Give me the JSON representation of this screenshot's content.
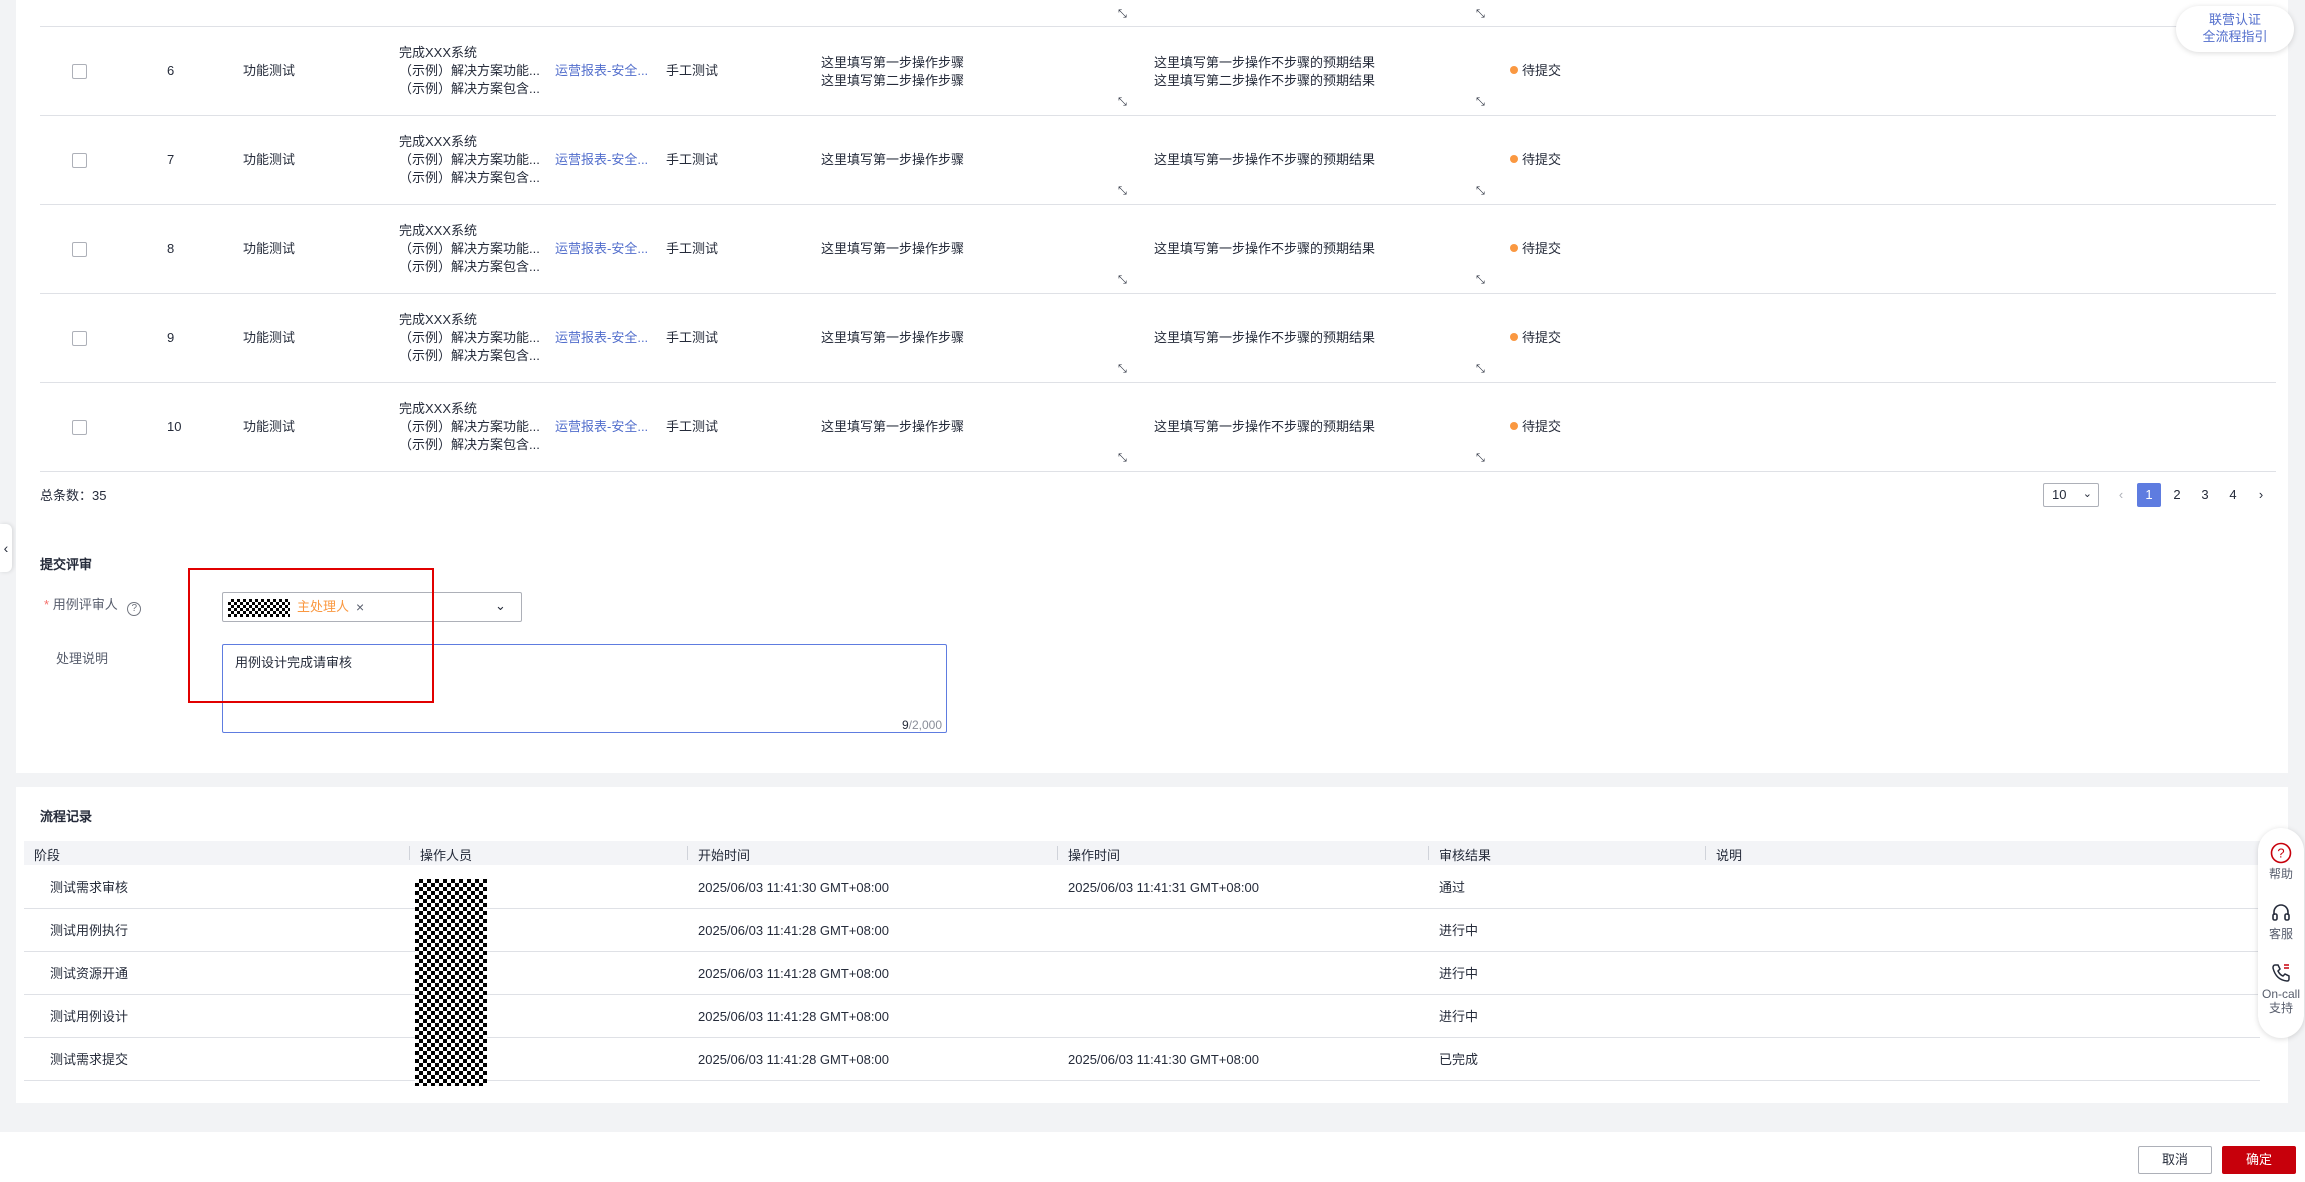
{
  "cases": {
    "rows": [
      {
        "no": "6",
        "type": "功能测试",
        "title": "完成XXX系统",
        "line1": "（示例）解决方案功能...",
        "line2": "（示例）解决方案包含...",
        "link": "运营报表-安全...",
        "method": "手工测试",
        "steps": [
          "这里填写第一步操作步骤",
          "这里填写第二步操作步骤"
        ],
        "expected": [
          "这里填写第一步操作不步骤的预期结果",
          "这里填写第二步操作不步骤的预期结果"
        ],
        "status": "待提交"
      },
      {
        "no": "7",
        "type": "功能测试",
        "title": "完成XXX系统",
        "line1": "（示例）解决方案功能...",
        "line2": "（示例）解决方案包含...",
        "link": "运营报表-安全...",
        "method": "手工测试",
        "steps": [
          "这里填写第一步操作步骤"
        ],
        "expected": [
          "这里填写第一步操作不步骤的预期结果"
        ],
        "status": "待提交"
      },
      {
        "no": "8",
        "type": "功能测试",
        "title": "完成XXX系统",
        "line1": "（示例）解决方案功能...",
        "line2": "（示例）解决方案包含...",
        "link": "运营报表-安全...",
        "method": "手工测试",
        "steps": [
          "这里填写第一步操作步骤"
        ],
        "expected": [
          "这里填写第一步操作不步骤的预期结果"
        ],
        "status": "待提交"
      },
      {
        "no": "9",
        "type": "功能测试",
        "title": "完成XXX系统",
        "line1": "（示例）解决方案功能...",
        "line2": "（示例）解决方案包含...",
        "link": "运营报表-安全...",
        "method": "手工测试",
        "steps": [
          "这里填写第一步操作步骤"
        ],
        "expected": [
          "这里填写第一步操作不步骤的预期结果"
        ],
        "status": "待提交"
      },
      {
        "no": "10",
        "type": "功能测试",
        "title": "完成XXX系统",
        "line1": "（示例）解决方案功能...",
        "line2": "（示例）解决方案包含...",
        "link": "运营报表-安全...",
        "method": "手工测试",
        "steps": [
          "这里填写第一步操作步骤"
        ],
        "expected": [
          "这里填写第一步操作不步骤的预期结果"
        ],
        "status": "待提交"
      }
    ],
    "total_label": "总条数：35",
    "page_size": "10",
    "pages": [
      "1",
      "2",
      "3",
      "4"
    ],
    "active_page": "1",
    "resize_icon": "resize-handle-icon"
  },
  "review": {
    "section_title": "提交评审",
    "reviewer_label": "用例评审人",
    "reviewer_tag": "主处理人",
    "remark_label": "处理说明",
    "remark_value": "用例设计完成请审核",
    "char_count": "9",
    "char_max": "/2,000"
  },
  "flow": {
    "title": "流程记录",
    "headers": [
      "阶段",
      "操作人员",
      "开始时间",
      "操作时间",
      "审核结果",
      "说明"
    ],
    "rows": [
      {
        "stage": "测试需求审核",
        "start": "2025/06/03 11:41:30 GMT+08:00",
        "op_time": "2025/06/03 11:41:31 GMT+08:00",
        "result": "通过"
      },
      {
        "stage": "测试用例执行",
        "start": "2025/06/03 11:41:28 GMT+08:00",
        "op_time": "",
        "result": "进行中"
      },
      {
        "stage": "测试资源开通",
        "start": "2025/06/03 11:41:28 GMT+08:00",
        "op_time": "",
        "result": "进行中"
      },
      {
        "stage": "测试用例设计",
        "start": "2025/06/03 11:41:28 GMT+08:00",
        "op_time": "",
        "result": "进行中"
      },
      {
        "stage": "测试需求提交",
        "start": "2025/06/03 11:41:28 GMT+08:00",
        "op_time": "2025/06/03 11:41:30 GMT+08:00",
        "result": "已完成"
      }
    ]
  },
  "footer": {
    "cancel": "取消",
    "confirm": "确定"
  },
  "float_guide": {
    "line1": "联营认证",
    "line2": "全流程指引"
  },
  "tools": {
    "help": "帮助",
    "service": "客服",
    "oncall1": "On-call",
    "oncall2": "支持"
  },
  "colors": {
    "primary": "#5e7ce0",
    "link": "#526ecc",
    "danger": "#c7000b",
    "warning": "#fa9841",
    "highlight": "#e10000"
  }
}
